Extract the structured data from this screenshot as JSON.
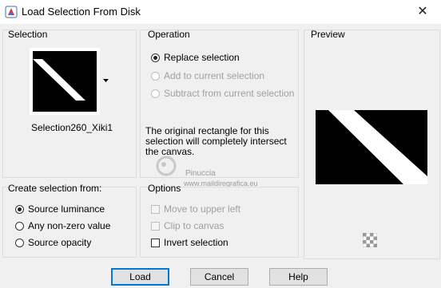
{
  "window": {
    "title": "Load Selection From Disk",
    "close_glyph": "✕"
  },
  "selection": {
    "label": "Selection",
    "file_name": "Selection260_Xiki1"
  },
  "operation": {
    "label": "Operation",
    "options": [
      {
        "label": "Replace selection",
        "selected": true,
        "enabled": true
      },
      {
        "label": "Add to current selection",
        "selected": false,
        "enabled": false
      },
      {
        "label": "Subtract from current selection",
        "selected": false,
        "enabled": false
      }
    ],
    "info": "The original rectangle for this selection will completely intersect the canvas."
  },
  "preview": {
    "label": "Preview"
  },
  "create_from": {
    "label": "Create selection from:",
    "options": [
      {
        "label": "Source luminance",
        "selected": true
      },
      {
        "label": "Any non-zero value",
        "selected": false
      },
      {
        "label": "Source opacity",
        "selected": false
      }
    ]
  },
  "options": {
    "label": "Options",
    "items": [
      {
        "label": "Move to upper left",
        "checked": false,
        "enabled": false
      },
      {
        "label": "Clip to canvas",
        "checked": false,
        "enabled": false
      },
      {
        "label": "Invert selection",
        "checked": false,
        "enabled": true
      }
    ]
  },
  "watermark": {
    "line1": "Pinuccia",
    "line2": "www.maildiregrafica.eu"
  },
  "buttons": {
    "load": "Load",
    "cancel": "Cancel",
    "help": "Help"
  }
}
